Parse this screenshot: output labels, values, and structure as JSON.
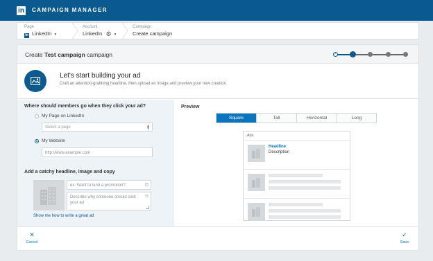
{
  "app": {
    "logo": "in",
    "title": "CAMPAIGN MANAGER"
  },
  "breadcrumbs": [
    {
      "small": "Page",
      "value": "LinkedIn",
      "icon": "linkedin-icon"
    },
    {
      "small": "Account",
      "value": "LinkedIn",
      "icon": "gear-icon"
    },
    {
      "small": "Campaign",
      "value": "Create campaign"
    }
  ],
  "header": {
    "prefix": "Create",
    "campaign_name": "Test campaign",
    "suffix": "campaign"
  },
  "progress": {
    "total_steps": 5,
    "current_step": 2,
    "done_color": "#0a5a8f",
    "todo_color": "#777777"
  },
  "intro": {
    "icon": "image-icon",
    "title": "Let's start building your ad",
    "subtitle": "Craft an attention-grabbing headline, then upload an image and preview your new creation."
  },
  "destination": {
    "question": "Where should members go when they click your ad?",
    "option_page": "My Page on LinkedIn",
    "select_placeholder": "Select a page",
    "option_website": "My Website",
    "selected": "My Website",
    "url_placeholder": "http://www.example.com"
  },
  "creative": {
    "heading": "Add a catchy headline, image and copy",
    "headline_placeholder": "ex: Want to land a promotion?",
    "headline_count": "25",
    "description_placeholder": "Describe why someone should click your ad",
    "description_count": "75",
    "help_link": "Show me how to write a great ad"
  },
  "preview": {
    "label": "Preview",
    "tabs": [
      "Square",
      "Tall",
      "Horizontal",
      "Long"
    ],
    "active_tab": "Square",
    "ads_label": "Ads",
    "headline": "Headline",
    "description": "Description"
  },
  "footer": {
    "cancel": "Cancel",
    "save": "Save"
  },
  "colors": {
    "brand": "#0a5a8f",
    "accent": "#0a75bc",
    "left_pane_bg": "#eef3f8"
  }
}
